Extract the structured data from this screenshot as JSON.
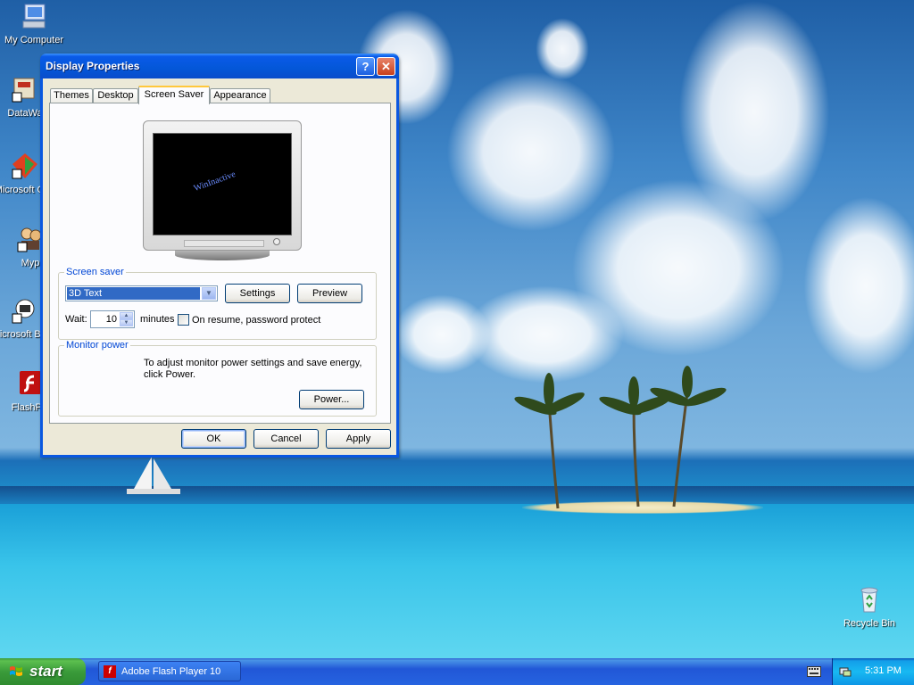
{
  "desktop": {
    "icons": [
      {
        "label": "My Computer"
      },
      {
        "label": "DataWa"
      },
      {
        "label": "Microsoft C++"
      },
      {
        "label": "Myp"
      },
      {
        "label": "Microsoft Basic"
      },
      {
        "label": "FlashPla"
      },
      {
        "label": "Recycle Bin"
      }
    ]
  },
  "window": {
    "title": "Display Properties",
    "help_glyph": "?",
    "close_glyph": "✕",
    "tabs": [
      {
        "label": "Themes"
      },
      {
        "label": "Desktop"
      },
      {
        "label": "Screen Saver"
      },
      {
        "label": "Appearance"
      }
    ],
    "active_tab": "Screen Saver",
    "preview_text": "WinInactive",
    "screen_saver": {
      "legend": "Screen saver",
      "selected": "3D Text",
      "settings_label": "Settings",
      "preview_label": "Preview",
      "wait_label": "Wait:",
      "wait_value": "10",
      "minutes_label": "minutes",
      "password_label": "On resume, password protect",
      "password_checked": false
    },
    "monitor_power": {
      "legend": "Monitor power",
      "description": "To adjust monitor power settings and save energy, click Power.",
      "power_label": "Power..."
    },
    "ok_label": "OK",
    "cancel_label": "Cancel",
    "apply_label": "Apply"
  },
  "taskbar": {
    "start_label": "start",
    "tasks": [
      {
        "label": "Adobe Flash Player 10"
      }
    ],
    "clock": "5:31 PM"
  },
  "colors": {
    "title_blue": "#0a5ae8",
    "start_green": "#3a9b3a",
    "dialog_face": "#ece9d8",
    "legend_blue": "#0046d5",
    "selection_blue": "#316ac5"
  }
}
